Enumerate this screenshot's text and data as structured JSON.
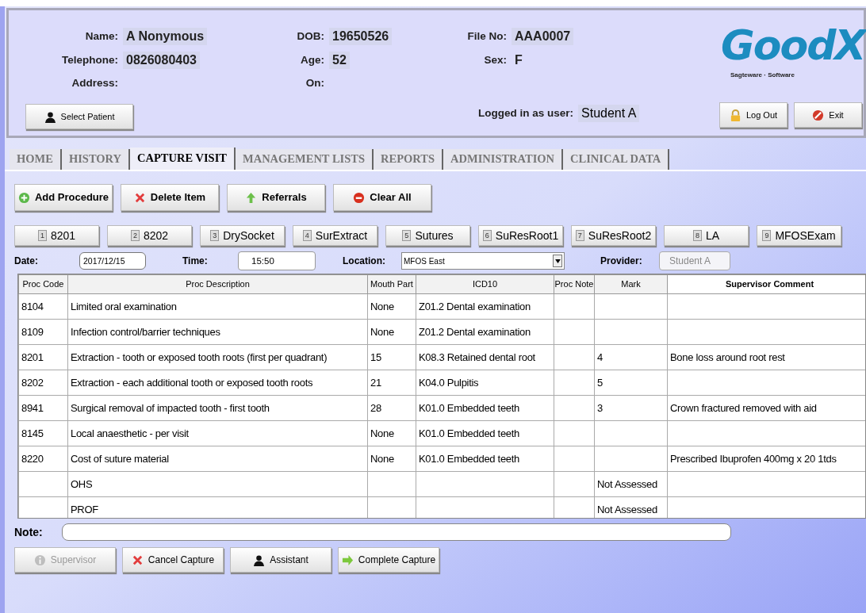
{
  "patient": {
    "name_label": "Name:",
    "name": "A Nonymous",
    "telephone_label": "Telephone:",
    "telephone": "0826080403",
    "address_label": "Address:",
    "dob_label": "DOB:",
    "dob": "19650526",
    "age_label": "Age:",
    "age": "52",
    "on_label": "On:",
    "file_no_label": "File No:",
    "file_no": "AAA0007",
    "sex_label": "Sex:",
    "sex": "F",
    "logged_in_label": "Logged in as user:",
    "logged_in_user": "Student A"
  },
  "logo": {
    "word": "GoodX",
    "tagline": "Sagteware · Software"
  },
  "header_buttons": [
    {
      "kind": "person",
      "label": "Select Patient"
    },
    {
      "kind": "lock",
      "label": "Log Out"
    },
    {
      "kind": "exit",
      "label": "Exit"
    }
  ],
  "tabs": [
    {
      "label": "HOME",
      "selected": false
    },
    {
      "label": "HISTORY",
      "selected": false
    },
    {
      "label": "CAPTURE VISIT",
      "selected": true
    },
    {
      "label": "MANAGEMENT LISTS",
      "selected": false
    },
    {
      "label": "REPORTS",
      "selected": false
    },
    {
      "label": "ADMINISTRATION",
      "selected": false
    },
    {
      "label": "CLINICAL DATA",
      "selected": false
    }
  ],
  "actions": [
    {
      "kind": "add",
      "label": "Add Procedure"
    },
    {
      "kind": "delete",
      "label": "Delete Item"
    },
    {
      "kind": "up",
      "label": "Referrals"
    },
    {
      "kind": "clear",
      "label": "Clear All"
    }
  ],
  "shortcuts": [
    {
      "key": "1",
      "label": "8201"
    },
    {
      "key": "2",
      "label": "8202"
    },
    {
      "key": "3",
      "label": "DrySocket"
    },
    {
      "key": "4",
      "label": "SurExtract"
    },
    {
      "key": "5",
      "label": "Sutures"
    },
    {
      "key": "6",
      "label": "SuResRoot1"
    },
    {
      "key": "7",
      "label": "SuResRoot2"
    },
    {
      "key": "8",
      "label": "LA"
    },
    {
      "key": "9",
      "label": "MFOSExam"
    }
  ],
  "visit": {
    "date_label": "Date:",
    "date": "2017/12/15",
    "time_label": "Time:",
    "time": "15:50",
    "location_label": "Location:",
    "location": "MFOS East",
    "provider_label": "Provider:",
    "provider": "Student A",
    "provider_disabled": true
  },
  "table": {
    "columns": [
      "Proc Code",
      "Proc Description",
      "Mouth Part",
      "ICD10",
      "Proc Note",
      "Mark",
      "Supervisor Comment"
    ],
    "rows": [
      [
        "8104",
        "Limited oral examination",
        "None",
        "Z01.2 Dental examination",
        "",
        "",
        ""
      ],
      [
        "8109",
        "Infection control/barrier techniques",
        "None",
        "Z01.2 Dental examination",
        "",
        "",
        ""
      ],
      [
        "8201",
        "Extraction - tooth or exposed tooth roots (first per quadrant)",
        "15",
        "K08.3 Retained dental root",
        "",
        "4",
        "Bone loss around root rest"
      ],
      [
        "8202",
        "Extraction - each additional tooth or exposed tooth roots",
        "21",
        "K04.0 Pulpitis",
        "",
        "5",
        ""
      ],
      [
        "8941",
        "Surgical removal of impacted tooth - first tooth",
        "28",
        "K01.0 Embedded teeth",
        "",
        "3",
        "Crown fractured removed with aid"
      ],
      [
        "8145",
        "Local anaesthetic - per visit",
        "None",
        "K01.0 Embedded teeth",
        "",
        "",
        ""
      ],
      [
        "8220",
        "Cost of suture material",
        "None",
        "K01.0 Embedded teeth",
        "",
        "",
        "Prescribed Ibuprofen 400mg x 20 1tds"
      ],
      [
        "",
        "OHS",
        "",
        "",
        "",
        "Not Assessed",
        ""
      ],
      [
        "",
        "PROF",
        "",
        "",
        "",
        "Not Assessed",
        ""
      ]
    ]
  },
  "note": {
    "label": "Note:"
  },
  "footer_buttons": [
    {
      "kind": "info",
      "label": "Supervisor",
      "disabled": true
    },
    {
      "kind": "delete",
      "label": "Cancel Capture",
      "disabled": false
    },
    {
      "kind": "person",
      "label": "Assistant",
      "disabled": false
    },
    {
      "kind": "arrow",
      "label": "Complete Capture",
      "disabled": false
    }
  ]
}
